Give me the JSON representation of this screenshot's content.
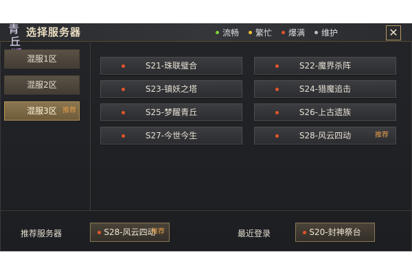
{
  "title": "选择服务器",
  "logo_text": "青丘狐",
  "legend": [
    {
      "label": "流畅",
      "color": "#7ed23a"
    },
    {
      "label": "繁忙",
      "color": "#f2c12e"
    },
    {
      "label": "爆满",
      "color": "#e4552b"
    },
    {
      "label": "维护",
      "color": "#bdbdbd"
    }
  ],
  "close_label": "✕",
  "zones": [
    {
      "label": "混服1区",
      "tag": ""
    },
    {
      "label": "混服2区",
      "tag": ""
    },
    {
      "label": "混服3区",
      "tag": "推荐"
    }
  ],
  "servers": [
    {
      "label": "S21-珠联璧合",
      "tag": "",
      "status_color": "#e4552b"
    },
    {
      "label": "S22-魔界杀阵",
      "tag": "",
      "status_color": "#e4552b"
    },
    {
      "label": "S23-镇妖之塔",
      "tag": "",
      "status_color": "#e4552b"
    },
    {
      "label": "S24-猎魔追击",
      "tag": "",
      "status_color": "#e4552b"
    },
    {
      "label": "S25-梦醒青丘",
      "tag": "",
      "status_color": "#e4552b"
    },
    {
      "label": "S26-上古遗族",
      "tag": "",
      "status_color": "#e4552b"
    },
    {
      "label": "S27-今世今生",
      "tag": "",
      "status_color": "#e4552b"
    },
    {
      "label": "S28-风云四动",
      "tag": "推荐",
      "status_color": "#e4552b"
    }
  ],
  "bottom": {
    "recommend_label": "推荐服务器",
    "recommend_server": "S28-风云四动",
    "recommend_tag": "推荐",
    "recent_label": "最近登录",
    "recent_server": "S20-封神祭台"
  }
}
